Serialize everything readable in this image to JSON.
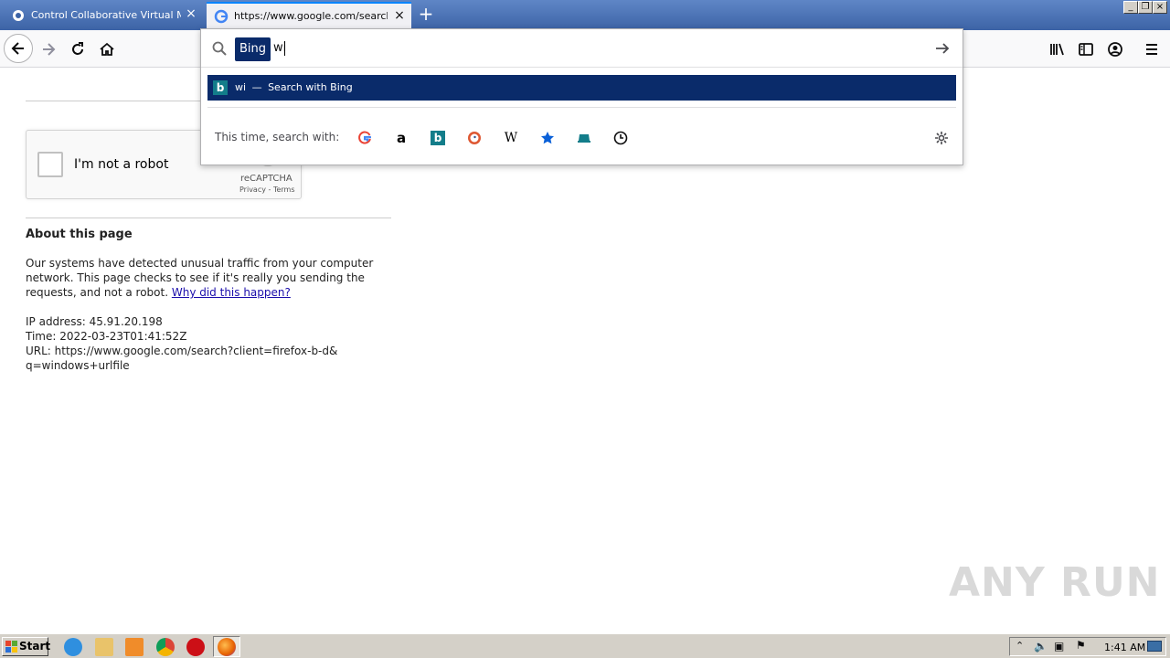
{
  "tabs": [
    {
      "title": "Control Collaborative Virtual Machi",
      "active": false
    },
    {
      "title": "https://www.google.com/search?c",
      "active": true
    }
  ],
  "window_controls": {
    "minimize": "_",
    "restore": "❐",
    "close": "×"
  },
  "urlbar": {
    "engine_chip": "Bing",
    "typed_text": "wi"
  },
  "suggestion": {
    "query": "wi",
    "separator": "—",
    "action": "Search with Bing"
  },
  "oneoff": {
    "label": "This time, search with:",
    "engines": [
      "google",
      "amazon",
      "bing",
      "duckduckgo",
      "wikipedia",
      "bookmarks",
      "tabs",
      "history"
    ]
  },
  "captcha": {
    "label": "I'm not a robot",
    "brand": "reCAPTCHA",
    "links": "Privacy - Terms"
  },
  "about": {
    "title": "About this page",
    "line1": "Our systems have detected unusual traffic from your computer",
    "line2": "network. This page checks to see if it's really you sending the",
    "line3": "requests, and not a robot.",
    "why_link": "Why did this happen?",
    "ip": "IP address: 45.91.20.198",
    "time": "Time: 2022-03-23T01:41:52Z",
    "url1": "URL: https://www.google.com/search?client=firefox-b-d&",
    "url2": "q=windows+urlfile"
  },
  "watermark": "ANY RUN",
  "taskbar": {
    "start": "Start",
    "clock": "1:41 AM"
  },
  "colors": {
    "accent": "#0a2b6a",
    "bing": "#137d8a",
    "link": "#1a0dab"
  }
}
